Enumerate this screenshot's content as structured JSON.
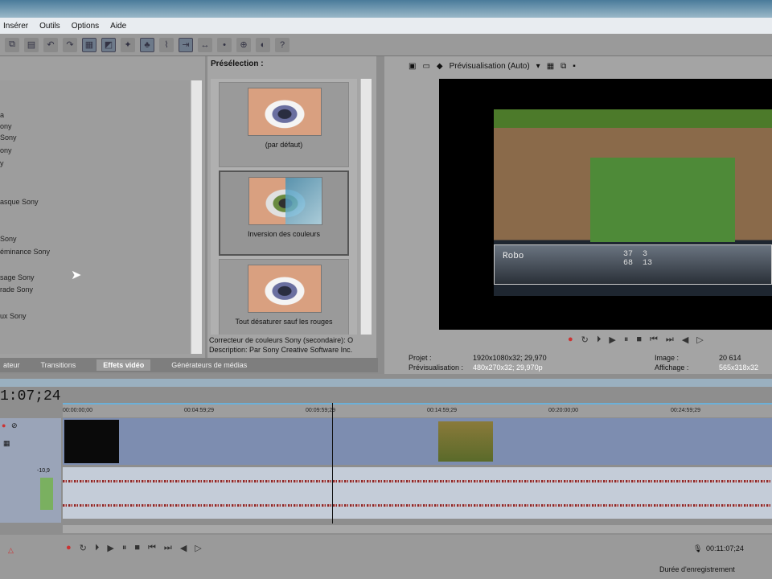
{
  "menu": [
    "Insérer",
    "Outils",
    "Options",
    "Aide"
  ],
  "left_list": [
    "a",
    "ony",
    "Sony",
    "ony",
    "y",
    "asque Sony",
    "Sony",
    "éminance Sony",
    "sage Sony",
    "rade Sony",
    "ux Sony"
  ],
  "presets": {
    "title": "Présélection :",
    "items": [
      "(par défaut)",
      "Inversion des couleurs",
      "Tout désaturer sauf les rouges"
    ],
    "fx_name": "Correcteur de couleurs Sony (secondaire): O",
    "description": "Description: Par Sony Creative Software Inc."
  },
  "tabs": [
    "ateur",
    "Transitions",
    "Effets vidéo",
    "Générateurs de médias"
  ],
  "preview": {
    "mode": "Prévisualisation (Auto)",
    "projet_label": "Projet :",
    "projet": "1920x1080x32; 29,970",
    "prev_label": "Prévisualisation :",
    "prev": "480x270x32; 29,970p",
    "image_label": "Image :",
    "image": "20 614",
    "affichage_label": "Affichage :",
    "affichage": "565x318x32",
    "hud_name": "Robo",
    "hud_stats": "37  3\n68  13"
  },
  "timeline": {
    "timecode": "1:07;24",
    "ticks": [
      "00:00:00;00",
      "00:04:59;29",
      "00:09:59;29",
      "00:14:59;29",
      "00:20:00;00",
      "00:24:59;29"
    ],
    "level": "-10,9",
    "bottom_timecode": "00:11:07;24",
    "status": "Durée d'enregistrement"
  }
}
